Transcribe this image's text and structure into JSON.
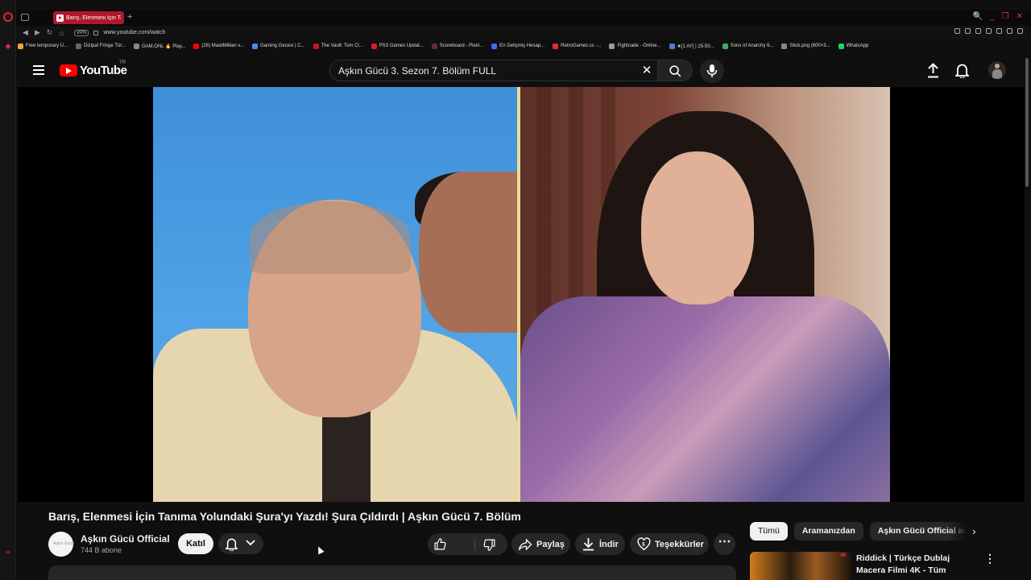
{
  "browser": {
    "tab_title": "Barış, Elenmesi İçin Ta",
    "tab_new": "+",
    "window_controls": [
      "🔍",
      "_",
      "❐",
      "✕"
    ],
    "url": "www.youtube.com/watch",
    "vpn_label": "VPN",
    "bookmarks": [
      {
        "label": "Free temporary U...",
        "color": "#f3a23b"
      },
      {
        "label": "Dizipal Fringe Tür...",
        "color": "#666666"
      },
      {
        "label": "GAM.ONL 🔥 Play...",
        "color": "#888888"
      },
      {
        "label": "(26) MaxilMillian v...",
        "color": "#ff0000"
      },
      {
        "label": "Gaming Gecesi | C...",
        "color": "#4a8af4"
      },
      {
        "label": "The Vault: Tom Cl...",
        "color": "#c8102e"
      },
      {
        "label": "PS3 Games Updat...",
        "color": "#d91a2a"
      },
      {
        "label": "Scoreboard - Pixel...",
        "color": "#6a2a2a"
      },
      {
        "label": "En Gelişmiş Hesap...",
        "color": "#3b6ff5"
      },
      {
        "label": "RetroGames.cc -...",
        "color": "#e22d2d"
      },
      {
        "label": "Fightcade - Online...",
        "color": "#999999"
      },
      {
        "label": "★[1 AY] | 25-50...",
        "color": "#5577dd"
      },
      {
        "label": "Sons of Anarchy 6...",
        "color": "#44aa66"
      },
      {
        "label": "Stick.png (600×3...",
        "color": "#888888"
      },
      {
        "label": "WhatsApp",
        "color": "#25d366"
      }
    ]
  },
  "youtube": {
    "logo_text": "YouTube",
    "country": "TR",
    "search_value": "Aşkın Gücü 3. Sezon 7. Bölüm FULL",
    "clear_glyph": "✕"
  },
  "video": {
    "title": "Barış, Elenmesi İçin Tanıma Yolundaki Şura'yı Yazdı! Şura Çıldırdı | Aşkın Gücü 7. Bölüm",
    "channel_name": "Aşkın Gücü Official",
    "channel_avatar_text": "Aşkın Gücü",
    "subscribers": "744 B abone",
    "join_label": "Katıl",
    "share_label": "Paylaş",
    "download_label": "İndir",
    "thanks_label": "Teşekkürler",
    "more_glyph": "⋯"
  },
  "sidebar": {
    "chips": [
      "Tümü",
      "Aramanızdan",
      "Aşkın Gücü Official adlı y"
    ],
    "next_glyph": "›",
    "recommendation": {
      "title": "Riddick | Türkçe Dublaj Macera Filmi 4K - Tüm",
      "thumb_badge": "4K",
      "more_glyph": "⋮"
    }
  },
  "colors": {
    "background": "#0f0f0f",
    "accent_red": "#ff0000",
    "opera_red": "#e0233b",
    "tab_red": "#b0172c"
  },
  "icons": [
    "search-icon",
    "mic-icon",
    "upload-icon",
    "bell-icon",
    "like-icon",
    "dislike-icon",
    "share-icon",
    "download-icon",
    "thanks-icon",
    "menu-icon"
  ]
}
